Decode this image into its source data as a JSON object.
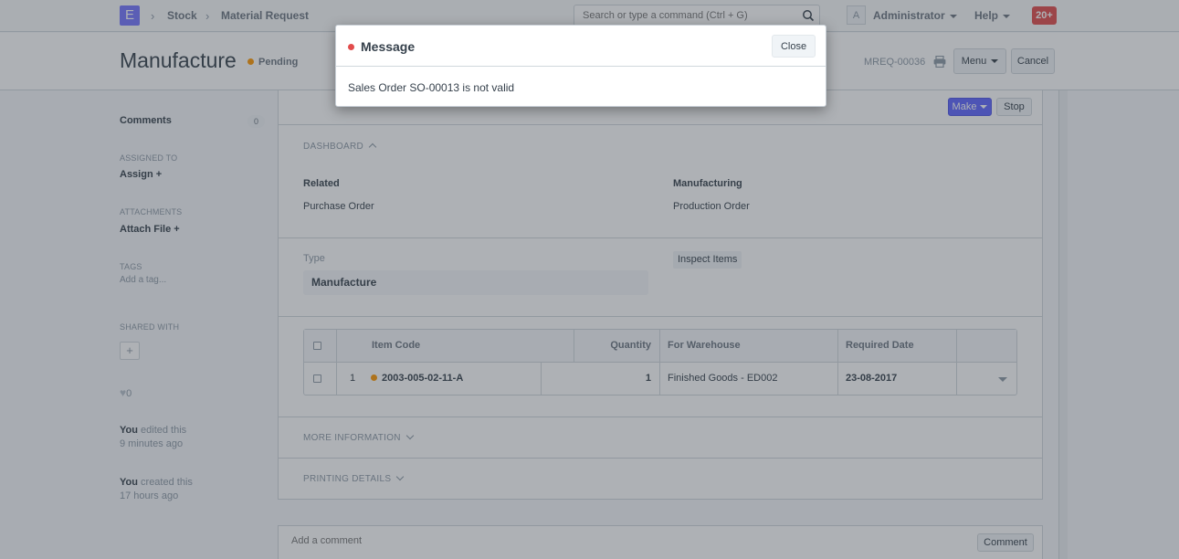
{
  "navbar": {
    "app_letter": "E",
    "breadcrumbs": [
      "Stock",
      "Material Request"
    ],
    "search_placeholder": "Search or type a command (Ctrl + G)",
    "avatar_letter": "A",
    "user": "Administrator",
    "help": "Help",
    "notifications": "20+"
  },
  "page_head": {
    "title": "Manufacture",
    "status": "Pending",
    "status_color": "#ff9800",
    "docname": "MREQ-00036",
    "menu_label": "Menu",
    "cancel_label": "Cancel"
  },
  "sidebar": {
    "comments_label": "Comments",
    "comments_count": "0",
    "assigned_to_label": "ASSIGNED TO",
    "assign_label": "Assign +",
    "attachments_label": "ATTACHMENTS",
    "attach_label": "Attach File +",
    "tags_label": "TAGS",
    "add_tag": "Add a tag...",
    "shared_with_label": "SHARED WITH",
    "add_shared": "+",
    "likes": "0",
    "activity": [
      {
        "who": "You",
        "action": " edited this",
        "when": "9 minutes ago"
      },
      {
        "who": "You",
        "action": " created this",
        "when": "17 hours ago"
      }
    ]
  },
  "form": {
    "make_label": "Make",
    "stop_label": "Stop",
    "dashboard_label": "DASHBOARD",
    "dashboard": {
      "col1_title": "Related",
      "col1_link": "Purchase Order",
      "col2_title": "Manufacturing",
      "col2_link": "Production Order"
    },
    "type_label": "Type",
    "type_value": "Manufacture",
    "inspect_label": "Inspect Items",
    "grid": {
      "headers": [
        "Item Code",
        "Quantity",
        "For Warehouse",
        "Required Date"
      ],
      "rows": [
        {
          "idx": "1",
          "item_code": "2003-005-02-11-A",
          "quantity": "1",
          "warehouse": "Finished Goods - ED002",
          "required_date": "23-08-2017"
        }
      ]
    },
    "more_info_label": "MORE INFORMATION",
    "printing_label": "PRINTING DETAILS"
  },
  "comment_box": {
    "placeholder": "Add a comment",
    "button": "Comment"
  },
  "modal": {
    "title": "Message",
    "indicator_color": "#e24c4c",
    "close_label": "Close",
    "message": "Sales Order SO-00013 is not valid"
  },
  "colors": {
    "brand": "#7575ff",
    "primary": "#5e64ff",
    "row_indicator": "#ff9800"
  }
}
